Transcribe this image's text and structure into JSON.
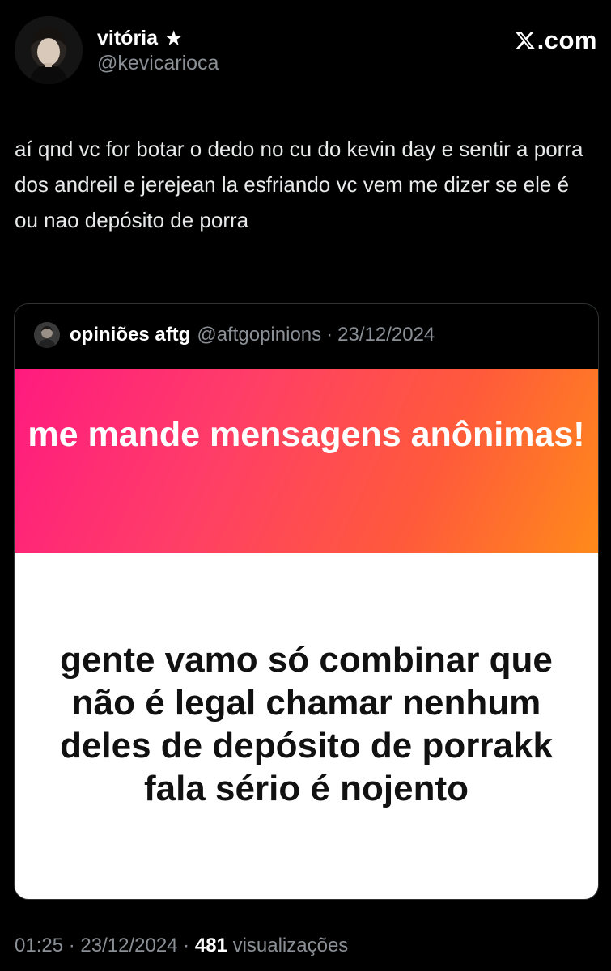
{
  "tweet": {
    "author": {
      "display_name": "vitória",
      "badge_icon": "star-icon",
      "handle": "@kevicarioca"
    },
    "site_label": ".com",
    "text": "aí qnd vc for botar o dedo no cu do kevin day e sentir a porra dos andreil e jerejean la esfriando vc vem me dizer se ele é ou nao depósito de porra",
    "quoted": {
      "display_name": "opiniões aftg",
      "handle": "@aftgopinions",
      "separator": "·",
      "date": "23/12/2024",
      "media": {
        "prompt": "me mande mensagens anônimas!",
        "answer": "gente vamo só combinar que não é legal chamar nenhum deles de depósito de porrakk fala sério é nojento",
        "gradient_colors": [
          "#ff1a7f",
          "#ff5a3b",
          "#ff8a1a"
        ]
      }
    },
    "meta": {
      "time": "01:25",
      "separator_1": " · ",
      "date": "23/12/2024",
      "separator_2": " · ",
      "views_count": "481",
      "views_label": "visualizações"
    }
  }
}
